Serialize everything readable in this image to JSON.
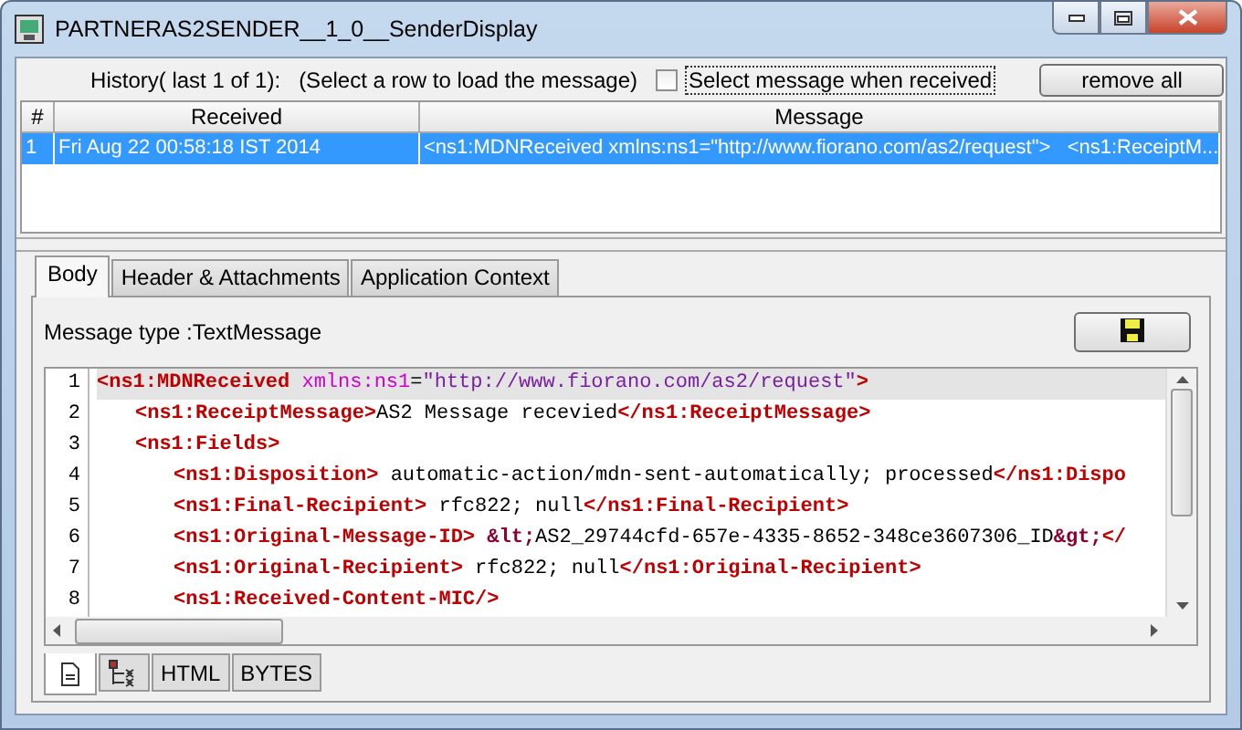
{
  "window": {
    "title": "PARTNERAS2SENDER__1_0__SenderDisplay"
  },
  "history": {
    "label": "History( last 1 of 1):",
    "hint": "(Select a row to load the message)",
    "auto_select": {
      "label": "Select message when received",
      "checked": false
    },
    "button": "remove all"
  },
  "table": {
    "columns": [
      "#",
      "Received",
      "Message"
    ],
    "rows": [
      {
        "cells": [
          "1",
          "Fri Aug 22 00:58:18 IST 2014",
          "<ns1:MDNReceived xmlns:ns1=\"http://www.fiorano.com/as2/request\">   <ns1:ReceiptM..."
        ],
        "selected": true
      }
    ]
  },
  "tabs": [
    {
      "label": "Body",
      "selected": true
    },
    {
      "label": "Header & Attachments",
      "selected": false
    },
    {
      "label": "Application Context",
      "selected": false
    }
  ],
  "message_type": "Message type :TextMessage",
  "editor": {
    "lines": [
      {
        "number": "1",
        "highlighted": true,
        "segments": [
          {
            "kind": "tag",
            "text": "<ns1:MDNReceived"
          },
          {
            "kind": "attr",
            "text": " xmlns:ns1"
          },
          {
            "kind": "text",
            "text": "="
          },
          {
            "kind": "value",
            "text": "\"http://www.fiorano.com/as2/request\""
          },
          {
            "kind": "tag",
            "text": ">"
          }
        ],
        "children": [
          {
            "number": "2",
            "highlighted": false,
            "segments": [
              {
                "kind": "tag",
                "text": "<ns1:ReceiptMessage>"
              },
              {
                "kind": "text",
                "text": "AS2 Message recevied"
              },
              {
                "kind": "tag",
                "text": "</ns1:ReceiptMessage>"
              }
            ]
          },
          {
            "number": "3",
            "highlighted": false,
            "segments": [
              {
                "kind": "tag",
                "text": "<ns1:Fields>"
              }
            ],
            "children": [
              {
                "number": "4",
                "highlighted": false,
                "segments": [
                  {
                    "kind": "tag",
                    "text": "<ns1:Disposition>"
                  },
                  {
                    "kind": "text",
                    "text": " automatic-action/mdn-sent-automatically; processed"
                  },
                  {
                    "kind": "tag",
                    "text": "</ns1:Dispo"
                  }
                ]
              },
              {
                "number": "5",
                "highlighted": false,
                "segments": [
                  {
                    "kind": "tag",
                    "text": "<ns1:Final-Recipient>"
                  },
                  {
                    "kind": "text",
                    "text": " rfc822; null"
                  },
                  {
                    "kind": "tag",
                    "text": "</ns1:Final-Recipient>"
                  }
                ]
              },
              {
                "number": "6",
                "highlighted": false,
                "segments": [
                  {
                    "kind": "tag",
                    "text": "<ns1:Original-Message-ID> "
                  },
                  {
                    "kind": "entity",
                    "text": "&lt;"
                  },
                  {
                    "kind": "text",
                    "text": "AS2_29744cfd-657e-4335-8652-348ce3607306_ID"
                  },
                  {
                    "kind": "entity",
                    "text": "&gt;"
                  },
                  {
                    "kind": "tag",
                    "text": "</"
                  }
                ]
              },
              {
                "number": "7",
                "highlighted": false,
                "segments": [
                  {
                    "kind": "tag",
                    "text": "<ns1:Original-Recipient>"
                  },
                  {
                    "kind": "text",
                    "text": " rfc822; null"
                  },
                  {
                    "kind": "tag",
                    "text": "</ns1:Original-Recipient>"
                  }
                ]
              },
              {
                "number": "8",
                "highlighted": false,
                "segments": [
                  {
                    "kind": "tag",
                    "text": "<ns1:Received-Content-MIC/>"
                  }
                ]
              }
            ]
          }
        ]
      }
    ]
  },
  "view_tabs": [
    {
      "kind": "document",
      "selected": true
    },
    {
      "kind": "tree",
      "selected": false
    },
    {
      "kind": "text",
      "label": "HTML",
      "selected": false
    },
    {
      "kind": "text",
      "label": "BYTES",
      "selected": false
    }
  ]
}
